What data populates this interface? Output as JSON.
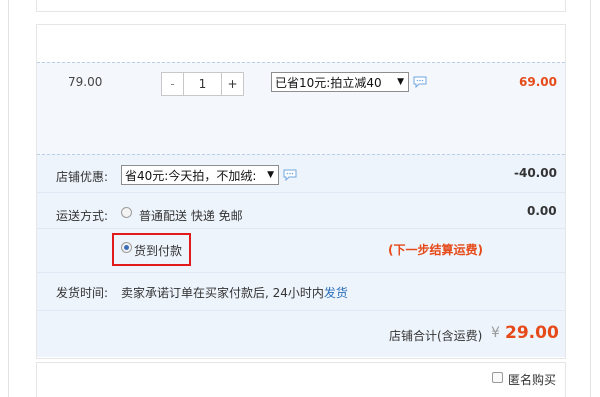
{
  "item": {
    "price": "79.00",
    "quantity": {
      "minus": "-",
      "value": "1",
      "plus": "+"
    },
    "discount_select": "已省10元:拍立减40",
    "subtotal": "69.00"
  },
  "shop_discount": {
    "label": "店铺优惠:",
    "select": "省40元:今天拍，不加绒:",
    "amount": "-40.00"
  },
  "shipping": {
    "label": "运送方式:",
    "option_normal": "普通配送 快递 免邮",
    "amount": "0.00",
    "option_cod": "货到付款",
    "cod_hint": "(下一步结算运费)"
  },
  "delivery": {
    "label": "发货时间:",
    "text": "卖家承诺订单在买家付款后, 24小时内",
    "link": "发货"
  },
  "total": {
    "label": "店铺合计(含运费)",
    "currency": "¥",
    "value": "29.00"
  },
  "anonymous": {
    "label": "匿名购买"
  },
  "colors": {
    "accent": "#e64a19",
    "link": "#2d6fb8",
    "highlight_border": "#e11b1b"
  }
}
